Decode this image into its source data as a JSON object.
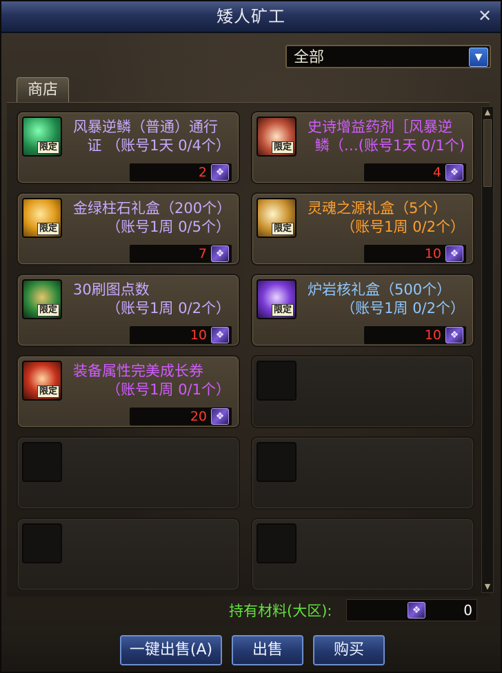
{
  "window": {
    "title": "矮人矿工",
    "close_glyph": "✕"
  },
  "filter": {
    "selected": "全部",
    "arrow_glyph": "▼"
  },
  "tabs": [
    {
      "label": "商店"
    }
  ],
  "items": [
    {
      "name_line1": "风暴逆鳞（普通）通行",
      "name_line2": "证 （账号1天 0/4个）",
      "name_color": "#c8a9ff",
      "badge": "限定",
      "icon": "green-scale-icon",
      "price": "2"
    },
    {
      "name_line1": "史诗增益药剂［风暴逆",
      "name_line2": "鳞（…(账号1天 0/1个)",
      "name_color": "#d05cff",
      "badge": "限定",
      "icon": "potion-icon",
      "price": "4"
    },
    {
      "name_line1": "金绿柱石礼盒（200个）",
      "name_line2": "（账号1周 0/5个）",
      "name_color": "#c8a9ff",
      "badge": "限定",
      "icon": "gold-gem-icon",
      "price": "7"
    },
    {
      "name_line1": "灵魂之源礼盒（5个）",
      "name_line2": "（账号1周 0/2个）",
      "name_color": "#ff9f2e",
      "badge": "限定",
      "icon": "soul-source-icon",
      "price": "10"
    },
    {
      "name_line1": "30刷图点数",
      "name_line2": "（账号1周 0/2个）",
      "name_color": "#c8a9ff",
      "badge": "限定",
      "icon": "green-bottle-icon",
      "price": "10"
    },
    {
      "name_line1": "炉岩核礼盒（500个）",
      "name_line2": "（账号1周 0/2个）",
      "name_color": "#8ec6ff",
      "badge": "限定",
      "icon": "lava-core-icon",
      "price": "10"
    },
    {
      "name_line1": "装备属性完美成长券",
      "name_line2": "（账号1周 0/1个）",
      "name_color": "#d05cff",
      "badge": "限定",
      "icon": "growth-ticket-icon",
      "price": "20"
    }
  ],
  "materials": {
    "label": "持有材料(大区):",
    "count": "0"
  },
  "buttons": {
    "sell_all": "一键出售(A)",
    "sell": "出售",
    "buy": "购买"
  },
  "coin_glyph": "❖"
}
